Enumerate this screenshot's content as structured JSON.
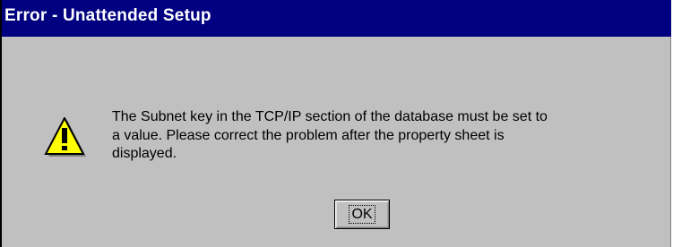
{
  "window": {
    "title": "Error - Unattended Setup"
  },
  "dialog": {
    "icon": "warning-icon",
    "message": "The Subnet key in the TCP/IP section of the database must be set to\na value. Please correct the problem after the property sheet is\ndisplayed.",
    "ok_label": "OK"
  },
  "colors": {
    "titlebar": "#000080",
    "title_text": "#ffffff",
    "dialog_face": "#c0c0c0",
    "warning_fill": "#ffff00"
  }
}
